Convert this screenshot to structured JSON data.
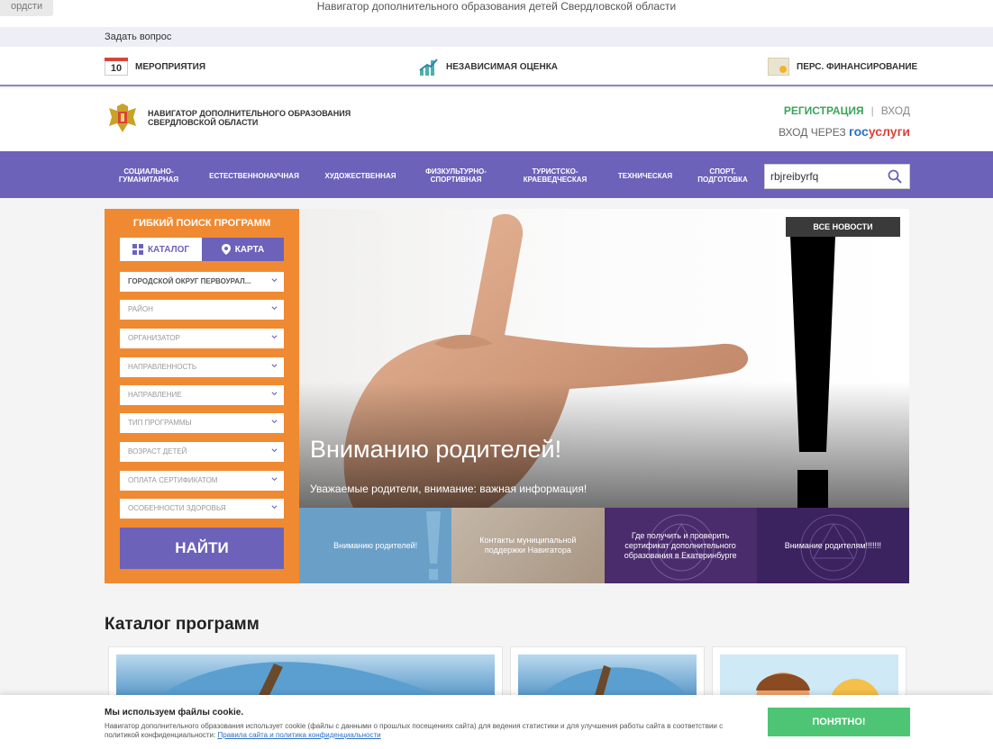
{
  "browser": {
    "tab_fragment": "ордсти",
    "page_title": "Навигатор дополнительного образования детей Свердловской области"
  },
  "topbar": {
    "ask_link": "Задать вопрос"
  },
  "top_menu": {
    "calendar_day": "10",
    "events": "МЕРОПРИЯТИЯ",
    "rating": "НЕЗАВИСИМАЯ ОЦЕНКА",
    "funding": "ПЕРС. ФИНАНСИРОВАНИЕ"
  },
  "header": {
    "logo_text": "НАВИГАТОР ДОПОЛНИТЕЛЬНОГО ОБРАЗОВАНИЯ СВЕРДЛОВСКОЙ ОБЛАСТИ",
    "register": "РЕГИСТРАЦИЯ",
    "separator": "|",
    "login": "ВХОД",
    "gos_login": "ВХОД ЧЕРЕЗ",
    "gos_a": "гос",
    "gos_b": "услуги"
  },
  "nav": {
    "items": [
      "СОЦИАЛЬНО-ГУМАНИТАРНАЯ",
      "ЕСТЕСТВЕННОНАУЧНАЯ",
      "ХУДОЖЕСТВЕННАЯ",
      "ФИЗКУЛЬТУРНО-СПОРТИВНАЯ",
      "ТУРИСТСКО-КРАЕВЕДЧЕСКАЯ",
      "ТЕХНИЧЕСКАЯ",
      "СПОРТ. ПОДГОТОВКА"
    ],
    "search_value": "rbjreibyrfq"
  },
  "filter": {
    "title": "ГИБКИЙ ПОИСК ПРОГРАММ",
    "catalog": "КАТАЛОГ",
    "map": "КАРТА",
    "selects": [
      "ГОРОДСКОЙ ОКРУГ ПЕРВОУРАЛ...",
      "РАЙОН",
      "ОРГАНИЗАТОР",
      "НАПРАВЛЕННОСТЬ",
      "НАПРАВЛЕНИЕ",
      "ТИП ПРОГРАММЫ",
      "ВОЗРАСТ ДЕТЕЙ",
      "ОПЛАТА СЕРТИФИКАТОМ",
      "ОСОБЕННОСТИ ЗДОРОВЬЯ"
    ],
    "find": "НАЙТИ"
  },
  "hero": {
    "title": "Вниманию родителей!",
    "subtitle": "Уважаемые родители, внимание: важная информация!",
    "all_news": "ВСЕ НОВОСТИ"
  },
  "tiles": [
    "Вниманию родителей!",
    "Контакты муниципальной поддержки Навигатора",
    "Где получить и проверить сертификат дополнительного образования в Екатеринбурге",
    "Внимание родителям!!!!!!!"
  ],
  "catalog": {
    "title": "Каталог программ"
  },
  "cookie": {
    "title": "Мы используем файлы cookie.",
    "text": "Навигатор дополнительного образования использует cookie (файлы с данными о прошлых посещениях сайта) для ведения статистики и для улучшения работы сайта в соответствии с политикой конфиденциальности: ",
    "link": "Правила сайта и политика конфиденциальности",
    "ok": "ПОНЯТНО!"
  },
  "colors": {
    "purple": "#6c62b9",
    "orange": "#f08a32",
    "green": "#4dc574",
    "register_green": "#3aa35a",
    "gos_blue": "#2b6fc9",
    "gos_red": "#d9443a"
  }
}
